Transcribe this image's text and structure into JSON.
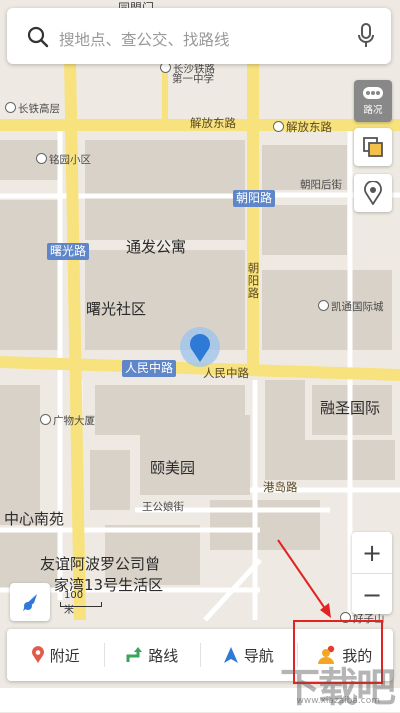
{
  "search": {
    "placeholder": "搜地点、查公交、找路线"
  },
  "map": {
    "road_tags": [
      "朝阳路",
      "曙光路",
      "人民中路"
    ],
    "roads": [
      "解放东路",
      "解放东路",
      "人民中路",
      "朝阳路",
      "港岛路",
      "王公娘街"
    ],
    "pois": [
      "长沙铁路第一中学",
      "长铁高层",
      "铭园小区",
      "朝阳后街",
      "凯通国际城",
      "广物大厦",
      "好子山"
    ],
    "areas": [
      "通发公寓",
      "曙光社区",
      "融圣国际",
      "颐美园",
      "中心南苑",
      "友谊阿波罗公司曾家湾13号生活区"
    ],
    "top_fragment": "同盟门",
    "first_school_line1": "长沙铁路",
    "first_school_line2": "第一中学",
    "area_last_line1": "友谊阿波罗公司曾",
    "area_last_line2": "家湾13号生活区"
  },
  "controls": {
    "traffic_label": "路况",
    "zoom_in": "+",
    "zoom_out": "−",
    "scale": "100米"
  },
  "bottom_bar": {
    "nearby": "附近",
    "route": "路线",
    "navigate": "导航",
    "mine": "我的"
  },
  "colors": {
    "road_major": "#f7e27e",
    "road_minor": "#ffffff",
    "block": "#d9d3ca",
    "accent": "#2e7ad6",
    "highlight": "#e32323"
  },
  "watermark": {
    "main": "下载吧",
    "sub": "www.xiazaiba.com"
  }
}
